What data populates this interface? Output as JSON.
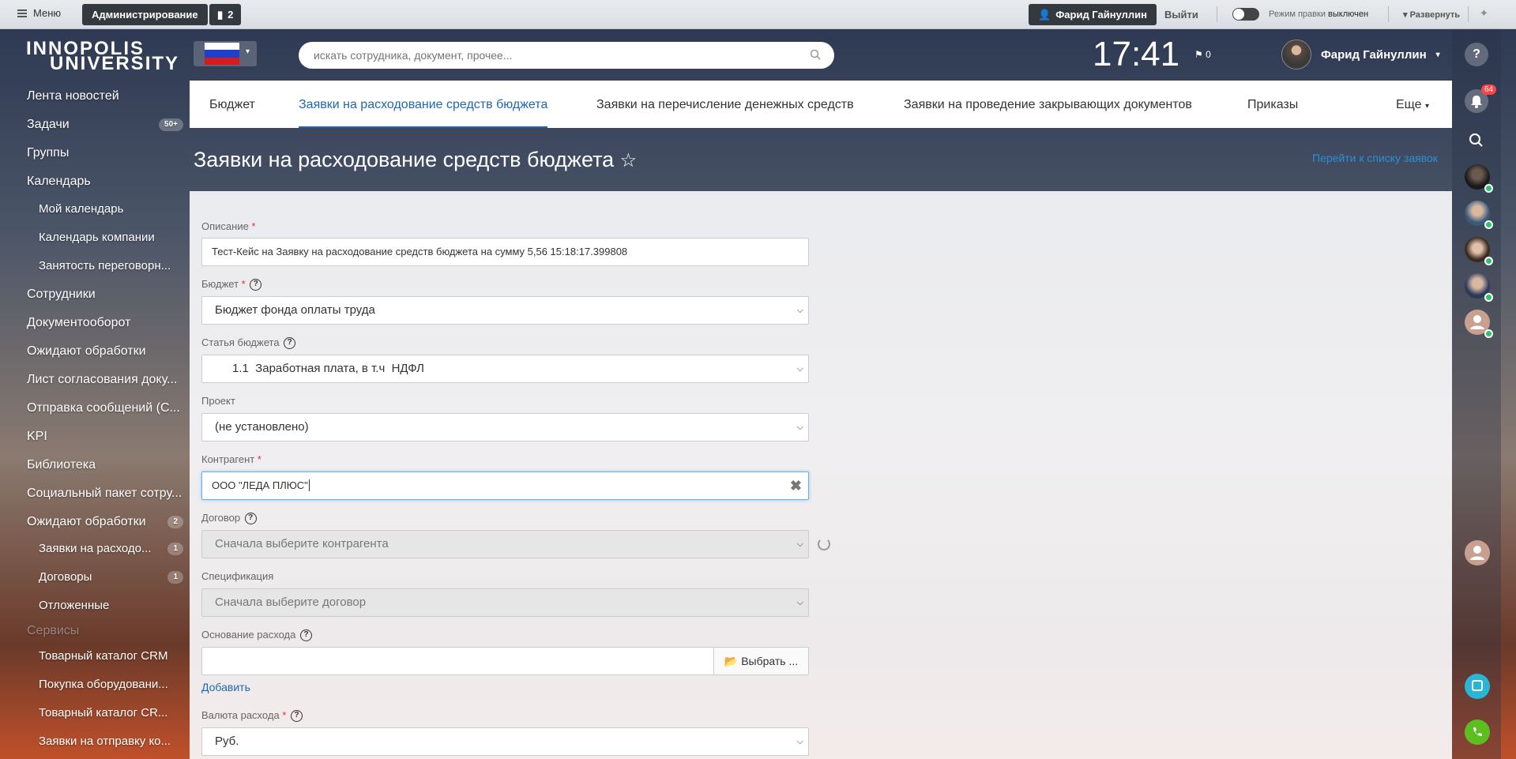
{
  "admin_bar": {
    "menu_label": "Меню",
    "admin_label": "Администрирование",
    "notif_count": "2",
    "user_label": "Фарид Гайнуллин",
    "logout_label": "Выйти",
    "edit_mode_label": "Режим правки",
    "edit_mode_state": "выключен",
    "expand_label": "Развернуть"
  },
  "header": {
    "logo_line1": "INNOPOLIS",
    "logo_line2": "UNIVERSITY",
    "search_placeholder": "искать сотрудника, документ, прочее...",
    "clock": "17:41",
    "flag_count": "0",
    "user_name": "Фарид Гайнуллин"
  },
  "right_rail": {
    "bell_count": "64",
    "help_label": "?"
  },
  "sidebar": {
    "items": [
      {
        "label": "Лента новостей"
      },
      {
        "label": "Задачи",
        "count": "50+"
      },
      {
        "label": "Группы"
      },
      {
        "label": "Календарь"
      },
      {
        "label": "Мой календарь"
      },
      {
        "label": "Календарь компании"
      },
      {
        "label": "Занятость переговорн..."
      },
      {
        "label": "Сотрудники"
      },
      {
        "label": "Документооборот"
      },
      {
        "label": "Ожидают обработки"
      },
      {
        "label": "Лист согласования доку..."
      },
      {
        "label": "Отправка сообщений (С..."
      },
      {
        "label": "KPI"
      },
      {
        "label": "Библиотека"
      },
      {
        "label": "Социальный пакет сотру..."
      },
      {
        "label": "Ожидают обработки",
        "count": "2"
      },
      {
        "label": "Заявки на расходо...",
        "count": "1"
      },
      {
        "label": "Договоры",
        "count": "1"
      },
      {
        "label": "Отложенные"
      },
      {
        "label": "Сервисы"
      },
      {
        "label": "Товарный каталог CRM"
      },
      {
        "label": "Покупка оборудовани..."
      },
      {
        "label": "Товарный каталог CR..."
      },
      {
        "label": "Заявки на отправку ко..."
      }
    ]
  },
  "tabs": [
    {
      "label": "Бюджет"
    },
    {
      "label": "Заявки на расходование средств бюджета"
    },
    {
      "label": "Заявки на перечисление денежных средств"
    },
    {
      "label": "Заявки на проведение закрывающих документов"
    },
    {
      "label": "Приказы"
    },
    {
      "label": "Еще"
    }
  ],
  "page": {
    "title": "Заявки на расходование средств бюджета",
    "star": "☆",
    "link": "Перейти к списку заявок"
  },
  "form": {
    "description": {
      "label": "Описание",
      "value": "Тест-Кейс на Заявку на расходование средств бюджета на сумму 5,56 15:18:17.399808"
    },
    "budget": {
      "label": "Бюджет",
      "value": "Бюджет фонда оплаты труда"
    },
    "budget_item": {
      "label": "Статья бюджета",
      "value": "1.1  Заработная плата, в т.ч  НДФЛ"
    },
    "project": {
      "label": "Проект",
      "value": "(не установлено)"
    },
    "counterparty": {
      "label": "Контрагент",
      "value": "ООО \"ЛЕДА ПЛЮС\""
    },
    "contract": {
      "label": "Договор",
      "value": "Сначала выберите контрагента"
    },
    "specification": {
      "label": "Спецификация",
      "value": "Сначала выберите договор"
    },
    "basis": {
      "label": "Основание расхода",
      "button": "Выбрать ..."
    },
    "add_label": "Добавить",
    "currency": {
      "label": "Валюта расхода",
      "value": "Руб."
    },
    "required_mark": "*",
    "help_mark": "?"
  }
}
